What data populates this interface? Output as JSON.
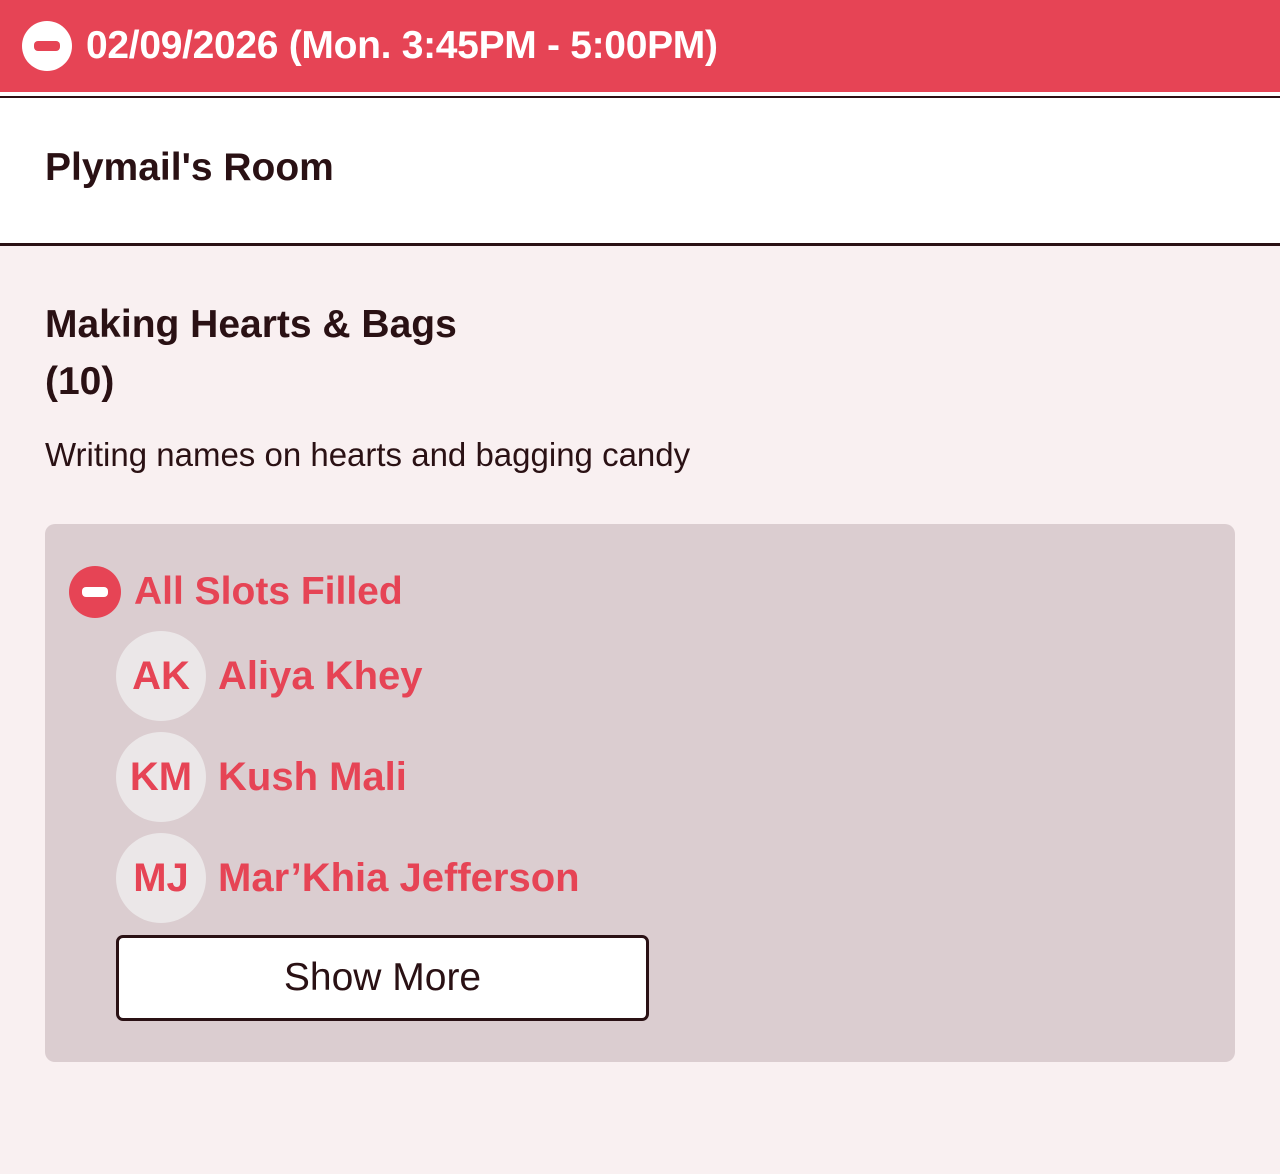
{
  "header": {
    "title": "02/09/2026 (Mon. 3:45PM - 5:00PM)",
    "icon": "minus-circle-icon",
    "color": "#e64455"
  },
  "room": {
    "name": "Plymail's Room"
  },
  "activity": {
    "title": "Making Hearts & Bags",
    "count": "(10)",
    "description": "Writing names on hearts and bagging candy"
  },
  "slots": {
    "status_label": "All Slots Filled",
    "status_icon": "minus-circle-icon",
    "volunteers": [
      {
        "initials": "AK",
        "name": "Aliya Khey"
      },
      {
        "initials": "KM",
        "name": "Kush Mali"
      },
      {
        "initials": "MJ",
        "name": "Mar’Khia Jefferson"
      }
    ],
    "show_more_label": "Show More"
  },
  "colors": {
    "accent": "#e64455",
    "panel_background": "#dbcdd0",
    "page_background": "#f9f0f1",
    "text": "#2a1114"
  }
}
